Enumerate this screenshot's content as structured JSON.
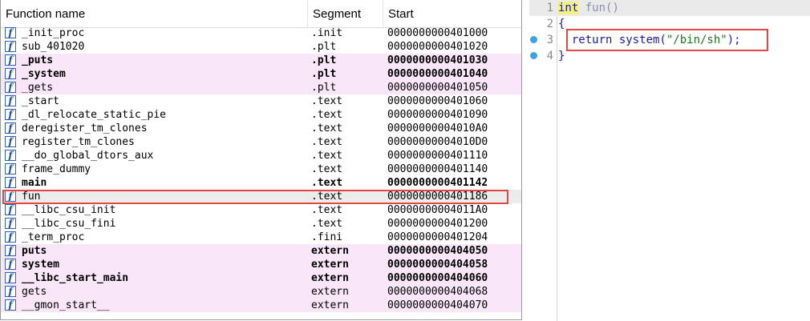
{
  "functions_window": {
    "columns": [
      "Function name",
      "Segment",
      "Start"
    ],
    "rows": [
      {
        "name": "_init_proc",
        "segment": ".init",
        "start": "0000000000401000",
        "style": "normal"
      },
      {
        "name": "sub_401020",
        "segment": ".plt",
        "start": "0000000000401020",
        "style": "normal"
      },
      {
        "name": "_puts",
        "segment": ".plt",
        "start": "0000000000401030",
        "style": "lib-bold"
      },
      {
        "name": "_system",
        "segment": ".plt",
        "start": "0000000000401040",
        "style": "lib-bold"
      },
      {
        "name": "_gets",
        "segment": ".plt",
        "start": "0000000000401050",
        "style": "lib"
      },
      {
        "name": "_start",
        "segment": ".text",
        "start": "0000000000401060",
        "style": "normal"
      },
      {
        "name": "_dl_relocate_static_pie",
        "segment": ".text",
        "start": "0000000000401090",
        "style": "normal"
      },
      {
        "name": "deregister_tm_clones",
        "segment": ".text",
        "start": "00000000004010A0",
        "style": "normal"
      },
      {
        "name": "register_tm_clones",
        "segment": ".text",
        "start": "00000000004010D0",
        "style": "normal"
      },
      {
        "name": "__do_global_dtors_aux",
        "segment": ".text",
        "start": "0000000000401110",
        "style": "normal"
      },
      {
        "name": "frame_dummy",
        "segment": ".text",
        "start": "0000000000401140",
        "style": "normal"
      },
      {
        "name": "main",
        "segment": ".text",
        "start": "0000000000401142",
        "style": "bold"
      },
      {
        "name": "fun",
        "segment": ".text",
        "start": "0000000000401186",
        "style": "selected"
      },
      {
        "name": "__libc_csu_init",
        "segment": ".text",
        "start": "00000000004011A0",
        "style": "normal"
      },
      {
        "name": "__libc_csu_fini",
        "segment": ".text",
        "start": "0000000000401200",
        "style": "normal"
      },
      {
        "name": "_term_proc",
        "segment": ".fini",
        "start": "0000000000401204",
        "style": "normal"
      },
      {
        "name": "puts",
        "segment": "extern",
        "start": "0000000000404050",
        "style": "lib-bold"
      },
      {
        "name": "system",
        "segment": "extern",
        "start": "0000000000404058",
        "style": "lib-bold"
      },
      {
        "name": "__libc_start_main",
        "segment": "extern",
        "start": "0000000000404060",
        "style": "lib-bold"
      },
      {
        "name": "gets",
        "segment": "extern",
        "start": "0000000000404068",
        "style": "lib"
      },
      {
        "name": "__gmon_start__",
        "segment": "extern",
        "start": "0000000000404070",
        "style": "lib"
      }
    ],
    "row_icon": "function-icon",
    "icon_glyph": "f",
    "colors": {
      "library_row": "#f9e6f9",
      "selected_row": "#ececec",
      "highlight_box": "#e04848"
    }
  },
  "pseudocode": {
    "lines": [
      {
        "num": "1",
        "kw": "int",
        "rest": " fun()",
        "breakpoint": false
      },
      {
        "num": "2",
        "text": "{",
        "breakpoint": false
      },
      {
        "num": "3",
        "pre": "  return system(",
        "str": "\"/bin/sh\"",
        "post": ");",
        "breakpoint": true
      },
      {
        "num": "4",
        "text": "}",
        "breakpoint": true
      }
    ],
    "colors": {
      "code_text": "#1a1aa6",
      "keyword_highlight": "#f3f37a",
      "string": "#1a7a1a",
      "breakpoint_dot": "#3aa5e6"
    }
  }
}
